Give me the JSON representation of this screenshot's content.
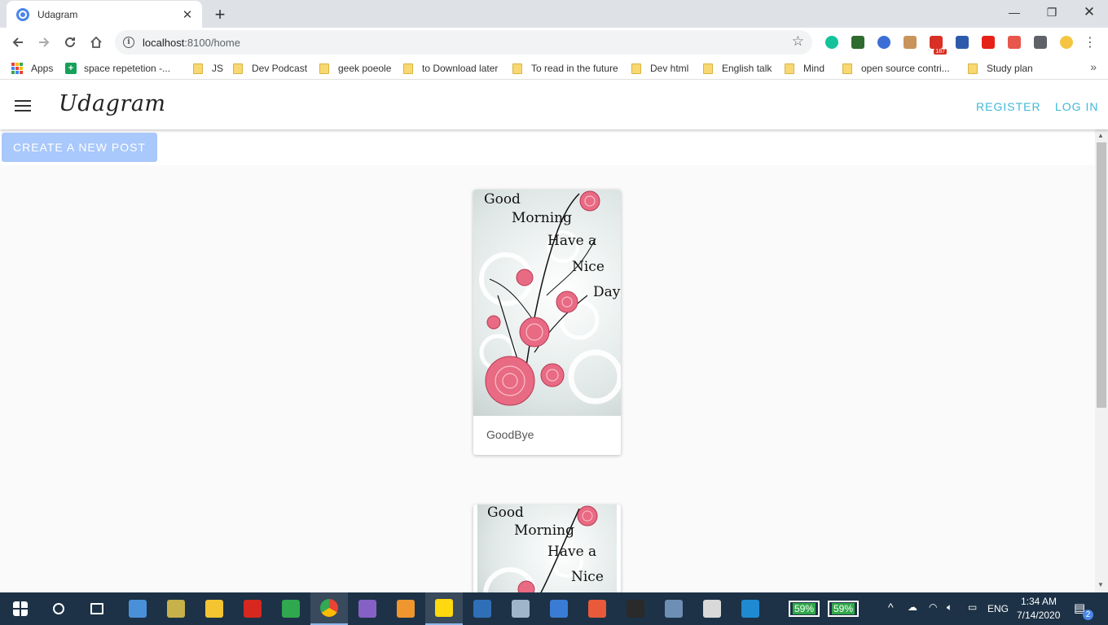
{
  "browser": {
    "tab_title": "Udagram",
    "url_host": "localhost",
    "url_path": ":8100/home",
    "bookmarks": [
      {
        "label": "Apps",
        "icon": "apps-grid-icon"
      },
      {
        "label": "space repetetion -...",
        "icon": "sheets-icon"
      },
      {
        "label": "JS",
        "icon": "folder-icon"
      },
      {
        "label": "Dev Podcast",
        "icon": "folder-icon"
      },
      {
        "label": "geek poeole",
        "icon": "folder-icon"
      },
      {
        "label": "to Download later",
        "icon": "folder-icon"
      },
      {
        "label": "To read in the future",
        "icon": "folder-icon"
      },
      {
        "label": "Dev html",
        "icon": "folder-icon"
      },
      {
        "label": "English talk",
        "icon": "folder-icon"
      },
      {
        "label": "Mind",
        "icon": "folder-icon"
      },
      {
        "label": "open source contri...",
        "icon": "folder-icon"
      },
      {
        "label": "Study plan",
        "icon": "folder-icon"
      }
    ],
    "extensions": [
      {
        "name": "grammarly-icon",
        "color": "#15c39a"
      },
      {
        "name": "hat-extension-icon",
        "color": "#2e6b2e"
      },
      {
        "name": "circle-extension-icon",
        "color": "#3b6fd6"
      },
      {
        "name": "box-extension-icon",
        "color": "#c9935c"
      },
      {
        "name": "gmail-icon",
        "color": "#d93025",
        "badge": "187"
      },
      {
        "name": "yoast-icon",
        "color": "#2e5aac"
      },
      {
        "name": "youtube-icon",
        "color": "#e62117"
      },
      {
        "name": "nodes-extension-icon",
        "color": "#e8574b"
      },
      {
        "name": "puzzle-extensions-icon",
        "color": "#5f6368"
      },
      {
        "name": "profile-avatar-icon",
        "color": "#f5c542"
      }
    ]
  },
  "app": {
    "title": "Udagram",
    "register_label": "REGISTER",
    "login_label": "LOG IN",
    "create_post_label": "CREATE A NEW POST",
    "posts": [
      {
        "caption": "GoodBye",
        "image_text": [
          "Good",
          "Morning",
          "Have a",
          "Nice",
          "Day"
        ]
      },
      {
        "caption": "",
        "image_text": [
          "Good",
          "Morning",
          "Have a",
          "Nice"
        ]
      }
    ]
  },
  "taskbar": {
    "battery_1": "59%",
    "battery_2": "59%",
    "language": "ENG",
    "time": "1:34 AM",
    "date": "7/14/2020",
    "notification_count": "2",
    "apps": [
      {
        "name": "start-icon",
        "color": "#ffffff"
      },
      {
        "name": "search-icon",
        "color": "#ffffff"
      },
      {
        "name": "task-view-icon",
        "color": "#ffffff"
      },
      {
        "name": "remote-desktop-icon",
        "color": "#4a90d9"
      },
      {
        "name": "tools-icon",
        "color": "#c7b14a"
      },
      {
        "name": "file-explorer-icon",
        "color": "#f4c431"
      },
      {
        "name": "acrobat-icon",
        "color": "#d6281e"
      },
      {
        "name": "green-app-icon",
        "color": "#2fa84f"
      },
      {
        "name": "chrome-icon",
        "color": "#4285f4"
      },
      {
        "name": "visual-studio-icon",
        "color": "#8661c5"
      },
      {
        "name": "orange-app-icon",
        "color": "#f0962f"
      },
      {
        "name": "sticky-notes-icon",
        "color": "#ffd90f"
      },
      {
        "name": "powershell-icon",
        "color": "#2f6fb7"
      },
      {
        "name": "photos-icon",
        "color": "#9fb5c9"
      },
      {
        "name": "blue-circle-icon",
        "color": "#3a7bd5"
      },
      {
        "name": "git-icon",
        "color": "#e85a3a"
      },
      {
        "name": "terminal-icon",
        "color": "#2a2a2a"
      },
      {
        "name": "elephant-icon",
        "color": "#6d8fb5"
      },
      {
        "name": "notepad-icon",
        "color": "#d9d9d9"
      },
      {
        "name": "vscode-icon",
        "color": "#1f8ad2"
      }
    ]
  }
}
